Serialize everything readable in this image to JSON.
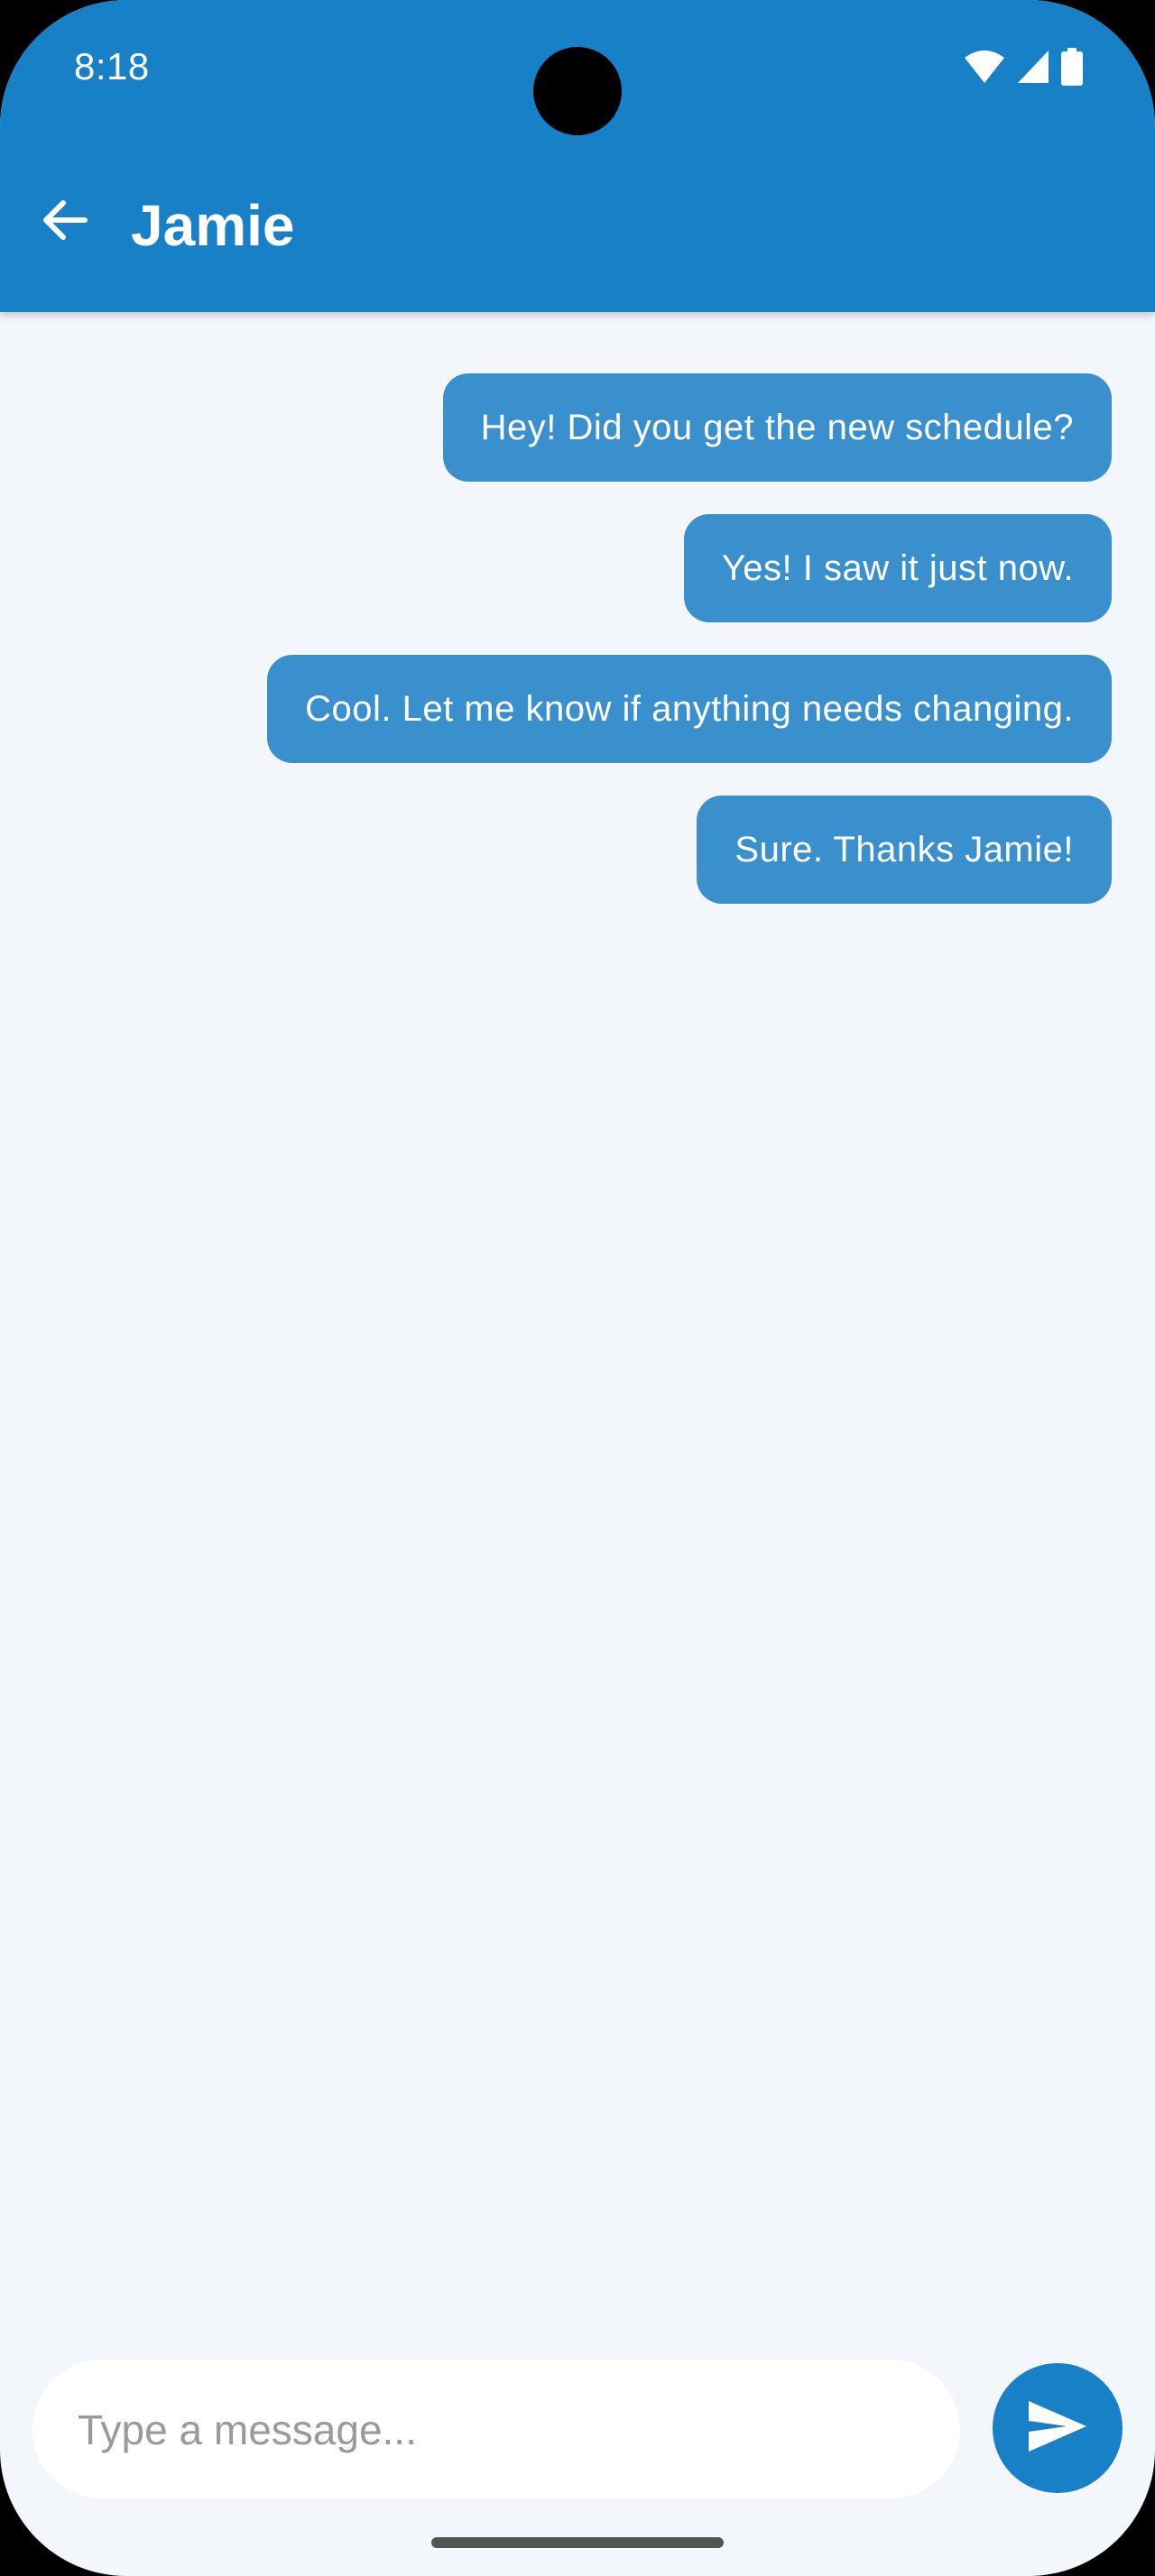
{
  "status_bar": {
    "time": "8:18",
    "icons": [
      "wifi-icon",
      "cellular-signal-icon",
      "battery-icon"
    ]
  },
  "header": {
    "back_icon": "arrow-left-icon",
    "title": "Jamie"
  },
  "messages": [
    {
      "text": "Hey! Did you get the new schedule?"
    },
    {
      "text": "Yes! I saw it just now."
    },
    {
      "text": "Cool. Let me know if anything needs changing."
    },
    {
      "text": "Sure. Thanks Jamie!"
    }
  ],
  "composer": {
    "placeholder": "Type a message...",
    "value": "",
    "send_icon": "send-icon"
  },
  "colors": {
    "accent": "#1780c7",
    "bubble": "#3a8fcd",
    "background": "#f3f6fa"
  }
}
